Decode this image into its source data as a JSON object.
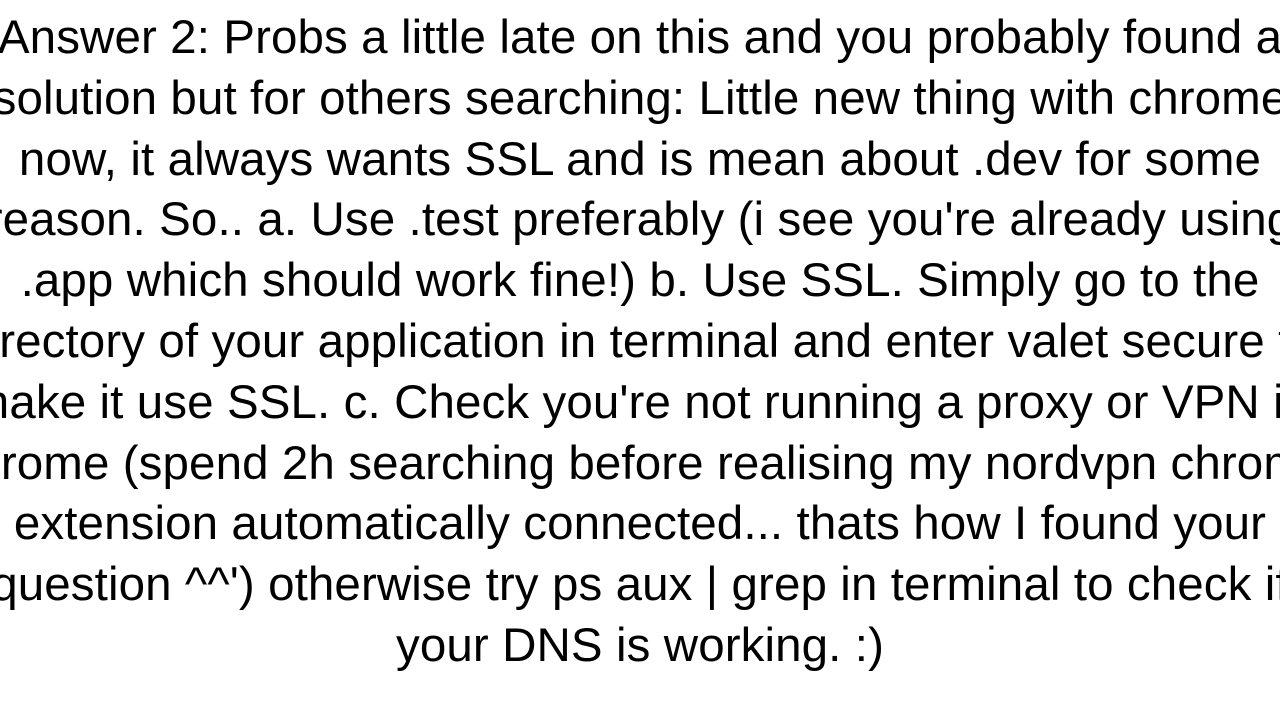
{
  "answer": {
    "text": "Answer 2: Probs a little late on this and you probably found a solution but for others searching: Little new thing with chrome now, it always wants SSL and is mean about .dev for some reason. So..  a. Use .test preferably (i see you're already using .app which should work fine!) b. Use SSL. Simply go to the directory of your application in terminal and enter valet secure to make it use SSL. c. Check you're not running a proxy or VPN in chrome (spend 2h searching before realising my nordvpn chrome extension automatically connected... thats how I found your question ^^') otherwise try ps aux | grep in terminal to check if your DNS is working. :)"
  }
}
